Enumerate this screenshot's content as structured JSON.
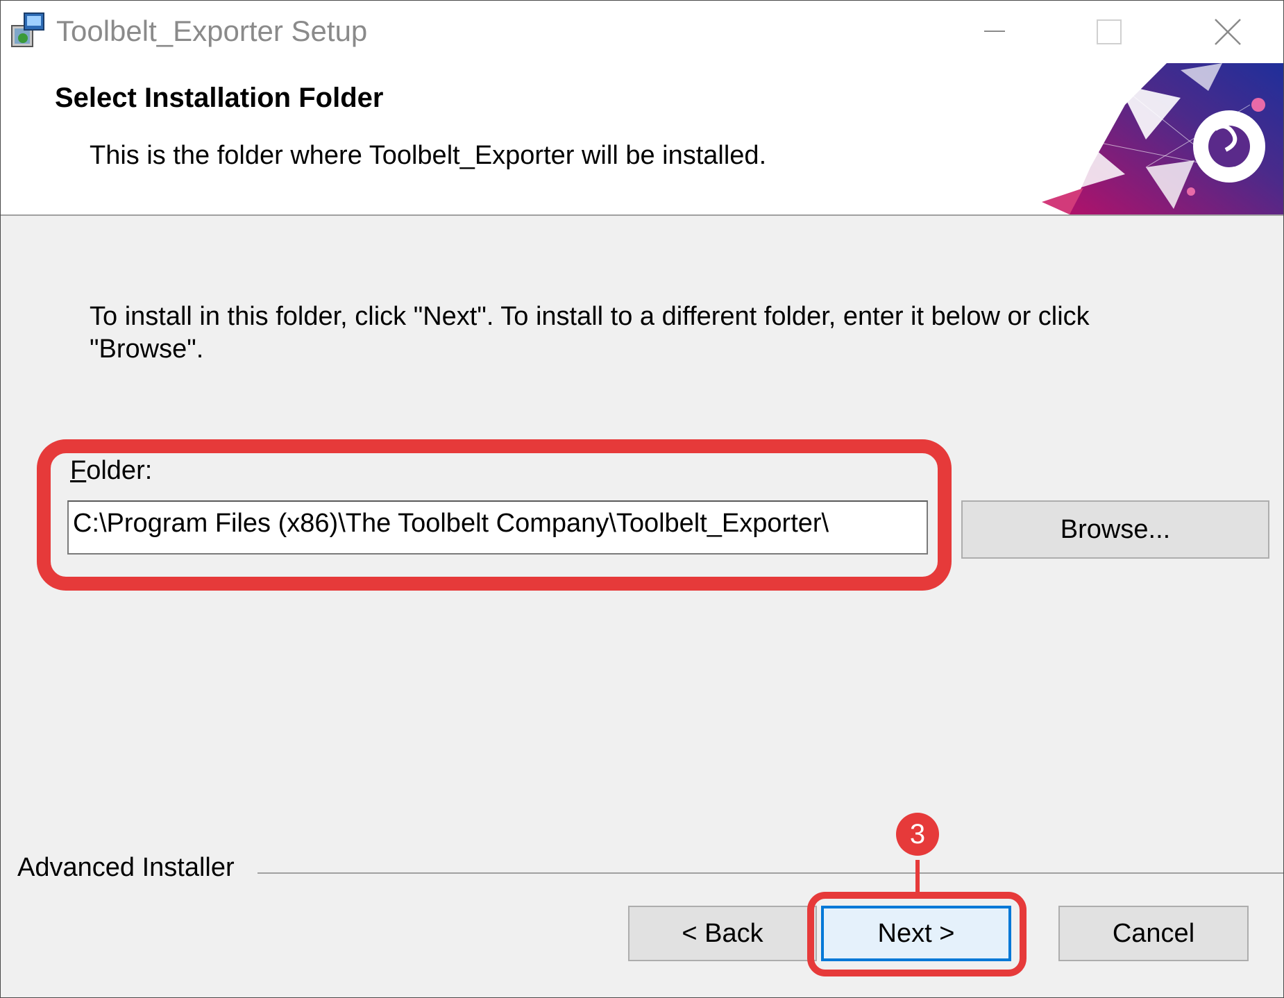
{
  "window": {
    "title": "Toolbelt_Exporter Setup",
    "icon": "installer-package-icon"
  },
  "header": {
    "title": "Select Installation Folder",
    "subtitle": "This is the folder where Toolbelt_Exporter will be installed."
  },
  "body": {
    "instructions": "To install in this folder, click \"Next\". To install to a different folder, enter it below or click \"Browse\".",
    "folder_label": "Folder:",
    "folder_value": "C:\\Program Files (x86)\\The Toolbelt Company\\Toolbelt_Exporter\\"
  },
  "buttons": {
    "browse": "Browse...",
    "back": "< Back",
    "next": "Next >",
    "cancel": "Cancel"
  },
  "footer": {
    "brand": "Advanced Installer"
  },
  "annotations": {
    "step_badge": "3",
    "highlight_color": "#e63a3a"
  }
}
